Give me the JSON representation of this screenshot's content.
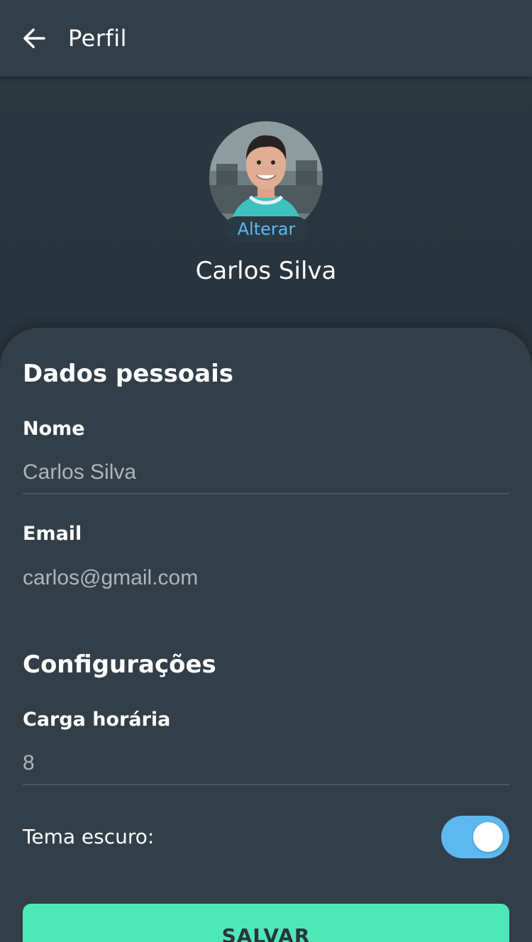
{
  "header": {
    "title": "Perfil",
    "back_icon": "arrow-left-icon"
  },
  "profile": {
    "name": "Carlos Silva",
    "change_photo_label": "Alterar"
  },
  "personal": {
    "section_title": "Dados pessoais",
    "name_label": "Nome",
    "name_value": "Carlos Silva",
    "email_label": "Email",
    "email_value": "carlos@gmail.com"
  },
  "settings": {
    "section_title": "Configurações",
    "workload_label": "Carga horária",
    "workload_value": "8",
    "dark_theme_label": "Tema escuro:",
    "dark_theme_on": true
  },
  "actions": {
    "save_label": "SALVAR"
  },
  "colors": {
    "accent_blue": "#5db8f0",
    "save_green": "#4de8b6",
    "header_bg": "#333f48",
    "card_bg": "#323f48"
  }
}
